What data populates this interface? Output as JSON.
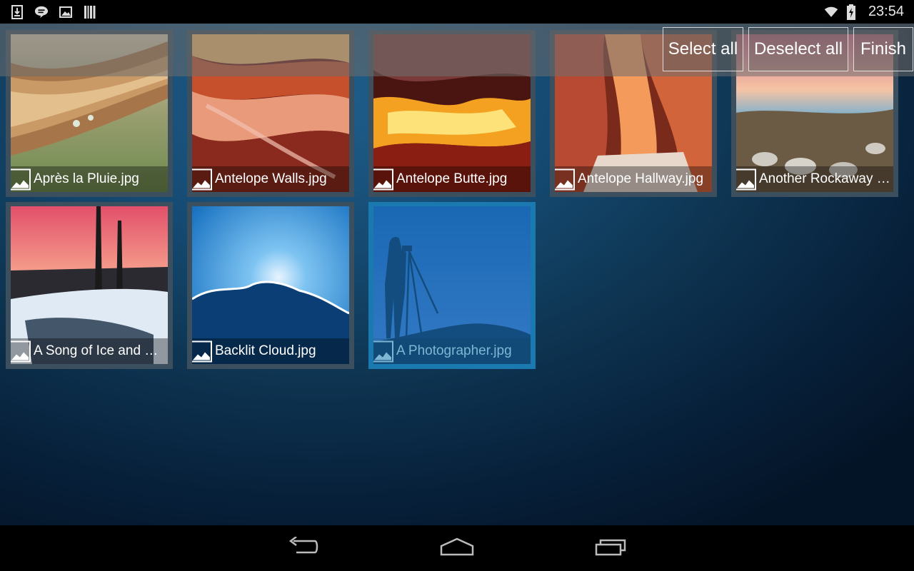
{
  "status_bar": {
    "time": "23:54",
    "left_icons": [
      "download-icon",
      "chat-icon",
      "image-icon",
      "barcode-icon"
    ],
    "right_icons": [
      "wifi-icon",
      "battery-charging-icon"
    ]
  },
  "action_bar": {
    "select_all": "Select all",
    "deselect_all": "Deselect all",
    "finish": "Finish"
  },
  "gallery": {
    "items": [
      {
        "name": "Après la Pluie.jpg",
        "selected": false
      },
      {
        "name": "Antelope Walls.jpg",
        "selected": false
      },
      {
        "name": "Antelope Butte.jpg",
        "selected": false
      },
      {
        "name": "Antelope Hallway.jpg",
        "selected": false
      },
      {
        "name": "Another Rockaway S...",
        "selected": false
      },
      {
        "name": "A Song of Ice and Fir...",
        "selected": false
      },
      {
        "name": "Backlit Cloud.jpg",
        "selected": false
      },
      {
        "name": "A Photographer.jpg",
        "selected": true
      }
    ]
  },
  "colors": {
    "selected_border": "#1a7ab0",
    "tile_border": "#3b4f5e",
    "background": "#154a72"
  },
  "nav_bar": {
    "icons": [
      "back-icon",
      "home-icon",
      "recents-icon"
    ]
  }
}
